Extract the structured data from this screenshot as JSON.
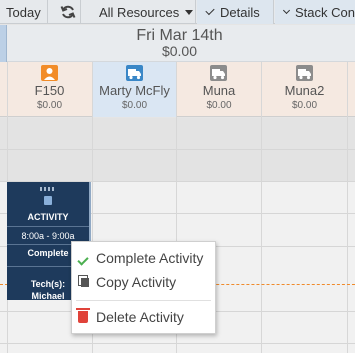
{
  "toolbar": {
    "today_label": "Today",
    "resources_label": "All Resources",
    "details_label": "Details",
    "stack_label": "Stack Con"
  },
  "header": {
    "date": "Fri Mar 14th",
    "day_total": "$0.00"
  },
  "resources": [
    {
      "name": "F150",
      "amount": "$0.00",
      "icon": "person-icon",
      "color": "#f28c28"
    },
    {
      "name": "Marty McFly",
      "amount": "$0.00",
      "icon": "truck-icon",
      "color": "#3a87c7",
      "selected": true
    },
    {
      "name": "Muna",
      "amount": "$0.00",
      "icon": "truck-icon",
      "color": "#8c8c8c"
    },
    {
      "name": "Muna2",
      "amount": "$0.00",
      "icon": "truck-icon",
      "color": "#8c8c8c"
    }
  ],
  "activity": {
    "title": "ACTIVITY",
    "time": "8:00a - 9:00a",
    "status": "Complete",
    "tech_label": "Tech(s):",
    "tech": "Michael"
  },
  "context_menu": {
    "complete": "Complete Activity",
    "copy": "Copy Activity",
    "delete": "Delete Activity"
  },
  "colors": {
    "card_bg": "#1e3a5c",
    "now_line": "#f08a2a",
    "complete_icon": "#4caf50",
    "delete_icon": "#e0433a"
  }
}
